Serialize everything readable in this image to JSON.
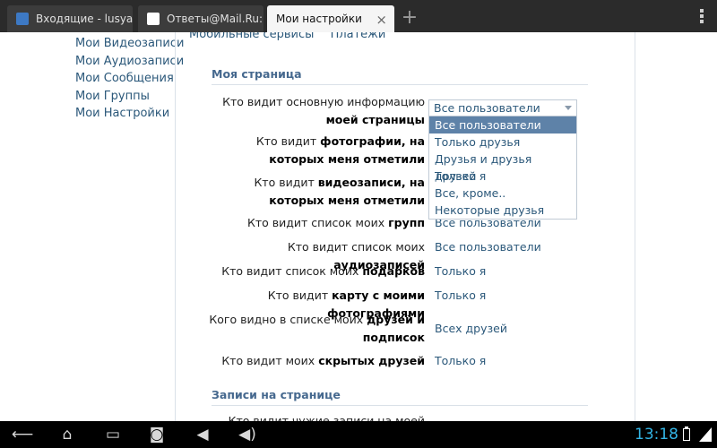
{
  "browser": {
    "tabs": [
      {
        "label": "Входящие - lusya...",
        "favicon_color": "#3d79c4"
      },
      {
        "label": "Ответы@Mail.Ru:...",
        "favicon_color": "#ffffff"
      },
      {
        "label": "Мои настройки",
        "close": "×"
      }
    ],
    "new_tab": "+"
  },
  "leftnav": {
    "items": [
      "Мои Видеозаписи",
      "Мои Аудиозаписи",
      "Мои Сообщения",
      "Мои Группы",
      "Мои Настройки"
    ]
  },
  "subtabs": [
    "Мобильные сервисы",
    "Платежи"
  ],
  "sections": {
    "my_page": "Моя страница",
    "wall_posts": "Записи на странице"
  },
  "rows": [
    {
      "q1": "Кто видит основную информацию ",
      "q2": "моей страницы",
      "value": ""
    },
    {
      "q1": "Кто видит ",
      "q2": "фотографии, на которых меня отметили",
      "value": ""
    },
    {
      "q1": "Кто видит ",
      "q2": "видеозаписи, на которых меня отметили",
      "value": ""
    },
    {
      "q1": "Кто видит список моих ",
      "q2": "групп",
      "value": "Все пользователи"
    },
    {
      "q1": "Кто видит список моих ",
      "q2": "аудиозаписей",
      "value": "Все пользователи"
    },
    {
      "q1": "Кто видит список моих ",
      "q2": "подарков",
      "value": "Только я"
    },
    {
      "q1": "Кто видит ",
      "q2": "карту с моими фотографиями",
      "value": "Только я"
    },
    {
      "q1": "Кого видно в списке моих ",
      "q2": "друзей и подписок",
      "value": "Всех друзей"
    },
    {
      "q1": "Кто видит моих ",
      "q2": "скрытых друзей",
      "value": "Только я"
    }
  ],
  "next_row_partial": "Кто видит чужие записи на моей",
  "dropdown": {
    "selected": "Все пользователи",
    "options": [
      "Все пользователи",
      "Только друзья",
      "Друзья и друзья друзей",
      "Только я",
      "Все, кроме..",
      "Некоторые друзья"
    ]
  },
  "system": {
    "time": "13:18"
  }
}
